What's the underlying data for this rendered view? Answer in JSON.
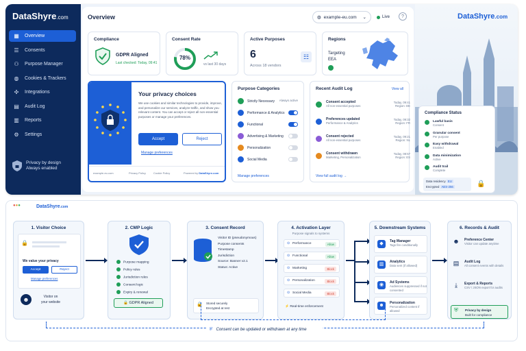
{
  "brand": {
    "name_a": "DataShyre",
    "name_b": ".com"
  },
  "sidebar": {
    "items": [
      {
        "label": "Overview",
        "icon": "grid-icon",
        "glyph": "▦"
      },
      {
        "label": "Consents",
        "icon": "list-icon",
        "glyph": "☰"
      },
      {
        "label": "Purpose Manager",
        "icon": "people-icon",
        "glyph": "⚇"
      },
      {
        "label": "Cookies & Trackers",
        "icon": "cookie-icon",
        "glyph": "◍"
      },
      {
        "label": "Integrations",
        "icon": "plug-icon",
        "glyph": "✣"
      },
      {
        "label": "Audit Log",
        "icon": "doc-icon",
        "glyph": "▤"
      },
      {
        "label": "Reports",
        "icon": "bar-chart-icon",
        "glyph": "▥"
      },
      {
        "label": "Settings",
        "icon": "gear-icon",
        "glyph": "⚙"
      }
    ],
    "privacy_line1": "Privacy by design",
    "privacy_line2": "Always enabled"
  },
  "header": {
    "title": "Overview",
    "domain": "example-eu.com",
    "live": "Live",
    "help": "?"
  },
  "cards": {
    "compliance": {
      "title": "Compliance",
      "status": "GDPR Aligned",
      "checked": "Last checked: Today, 09:41"
    },
    "consent_rate": {
      "title": "Consent Rate",
      "value": "78%",
      "percent": 78,
      "note": "vs last 30 days"
    },
    "active_purposes": {
      "title": "Active Purposes",
      "value": "6",
      "note": "Across 18 vendors"
    },
    "regions": {
      "title": "Regions",
      "targeting": "Targeting",
      "region": "EEA"
    }
  },
  "banner": {
    "title": "Your privacy choices",
    "text": "We use cookies and similar technologies to provide, improve, and personalize our services, analyze traffic, and show you relevant content. You can accept or reject all non-essential purposes or manage your preferences.",
    "accept": "Accept",
    "reject": "Reject",
    "manage": "Manage preferences",
    "footer_site": "example-eu.com",
    "footer_policy": "Privacy Policy",
    "footer_cookie": "Cookie Policy",
    "footer_powered": "Powered by",
    "footer_brand": "DataShyre.com"
  },
  "purpose_categories": {
    "title": "Purpose Categories",
    "items": [
      {
        "label": "Strictly Necessary",
        "state": "Always active",
        "on": true,
        "color": "#1f9e58"
      },
      {
        "label": "Performance & Analytics",
        "state": "",
        "on": true,
        "color": "#1d5fd6"
      },
      {
        "label": "Functional",
        "state": "",
        "on": true,
        "color": "#1d5fd6"
      },
      {
        "label": "Advertising & Marketing",
        "state": "",
        "on": false,
        "color": "#8a5cd6"
      },
      {
        "label": "Personalization",
        "state": "",
        "on": false,
        "color": "#e58a1f"
      },
      {
        "label": "Social Media",
        "state": "",
        "on": false,
        "color": "#1d5fd6"
      }
    ],
    "manage": "Manage preferences"
  },
  "audit": {
    "title": "Recent Audit Log",
    "view_all": "View all",
    "rows": [
      {
        "title": "Consent accepted",
        "sub": "All non-essential purposes",
        "time": "Today, 09:41",
        "region": "Region: DE",
        "color": "#1f9e58"
      },
      {
        "title": "Preferences updated",
        "sub": "Performance & Analytics",
        "time": "Today, 09:32",
        "region": "Region: FR",
        "color": "#1d5fd6"
      },
      {
        "title": "Consent rejected",
        "sub": "All non-essential purposes",
        "time": "Today, 09:21",
        "region": "Region: NL",
        "color": "#8a5cd6"
      },
      {
        "title": "Consent withdrawn",
        "sub": "Marketing, Personalization",
        "time": "Today, 08:57",
        "region": "Region: ES",
        "color": "#e58a1f"
      }
    ],
    "view_full": "View full audit log →"
  },
  "status": {
    "title": "Compliance Status",
    "items": [
      {
        "label": "Lawful basis",
        "sub": "Consent"
      },
      {
        "label": "Granular consent",
        "sub": "Per purpose"
      },
      {
        "label": "Easy withdrawal",
        "sub": "Enabled"
      },
      {
        "label": "Data minimization",
        "sub": "Active"
      },
      {
        "label": "Audit trail",
        "sub": "Complete"
      }
    ],
    "residency_label": "Data residency",
    "residency_value": "EU",
    "encrypted_label": "Encrypted",
    "encrypted_value": "AES-256"
  },
  "flow": {
    "col1": {
      "title": "1. Visitor Choice",
      "prompt": "We value your privacy",
      "accept": "Accept",
      "reject": "Reject",
      "manage": "Manage preferences",
      "visitor_a": "Visitor on",
      "visitor_b": "your website"
    },
    "col2": {
      "title": "2. CMP Logic",
      "items": [
        "Purpose mapping",
        "Policy rules",
        "Jurisdiction rules",
        "Consent logic",
        "Expiry & renewal"
      ],
      "badge": "GDPR Aligned"
    },
    "col3": {
      "title": "3. Consent Record",
      "fields": [
        "Visitor ID (pseudonymous)",
        "Purpose consents",
        "Timestamp",
        "Jurisdiction",
        "Source: Banner v2.1",
        "Status: Active"
      ],
      "stored_a": "Stored securely",
      "stored_b": "Encrypted at rest"
    },
    "col4": {
      "title": "4. Activation Layer",
      "sub": "Purpose signals to systems",
      "items": [
        {
          "label": "Performance",
          "badge": "Allow",
          "ok": true
        },
        {
          "label": "Functional",
          "badge": "Allow",
          "ok": true
        },
        {
          "label": "Marketing",
          "badge": "Block",
          "ok": false
        },
        {
          "label": "Personalization",
          "badge": "Block",
          "ok": false
        },
        {
          "label": "Social Media",
          "badge": "Block",
          "ok": false
        }
      ],
      "realtime": "Real-time enforcement"
    },
    "col5": {
      "title": "5. Downstream Systems",
      "items": [
        {
          "name": "Tag Manager",
          "sub": "Tags fire conditionally",
          "glyph": "◆"
        },
        {
          "name": "Analytics",
          "sub": "Data sent (if allowed)",
          "glyph": "▥"
        },
        {
          "name": "Ad Systems",
          "sub": "Audiences suppressed if not consented",
          "glyph": "◉"
        },
        {
          "name": "Personalization",
          "sub": "Personalized content if allowed",
          "glyph": "☻"
        }
      ]
    },
    "col6": {
      "title": "6. Records & Audit",
      "items": [
        {
          "name": "Preference Center",
          "sub": "Visitor can update anytime",
          "glyph": "☻"
        },
        {
          "name": "Audit Log",
          "sub": "All consent events with details",
          "glyph": "▤"
        },
        {
          "name": "Export & Reports",
          "sub": "CSV / JSON export for audits",
          "glyph": "⤓"
        }
      ],
      "privacy_a": "Privacy by design",
      "privacy_b": "Built for compliance"
    },
    "footer": "Consent can be updated or withdrawn at any time"
  }
}
